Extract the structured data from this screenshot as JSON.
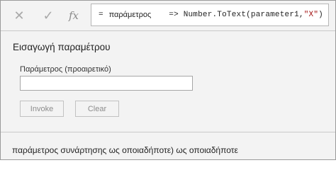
{
  "formula_bar": {
    "cancel_icon": "✕",
    "commit_icon": "✓",
    "fx_label": "fx",
    "equals": "=",
    "param_name": "παράμετρος",
    "code_prefix": "=> Number.ToText(parameter1,",
    "code_string": "\"X\"",
    "code_suffix": ")"
  },
  "panel": {
    "title": "Εισαγωγή παραμέτρου",
    "param_label": "Παράμετρος (προαιρετικό)",
    "param_value": "",
    "invoke_label": "Invoke",
    "clear_label": "Clear"
  },
  "footer": {
    "text": "παράμετρος συνάρτησης ως οποιαδήποτε) ως οποιαδήποτε"
  },
  "colors": {
    "background": "#f3f3f3",
    "string_literal": "#a31515",
    "disabled_text": "#8c8c8c"
  }
}
